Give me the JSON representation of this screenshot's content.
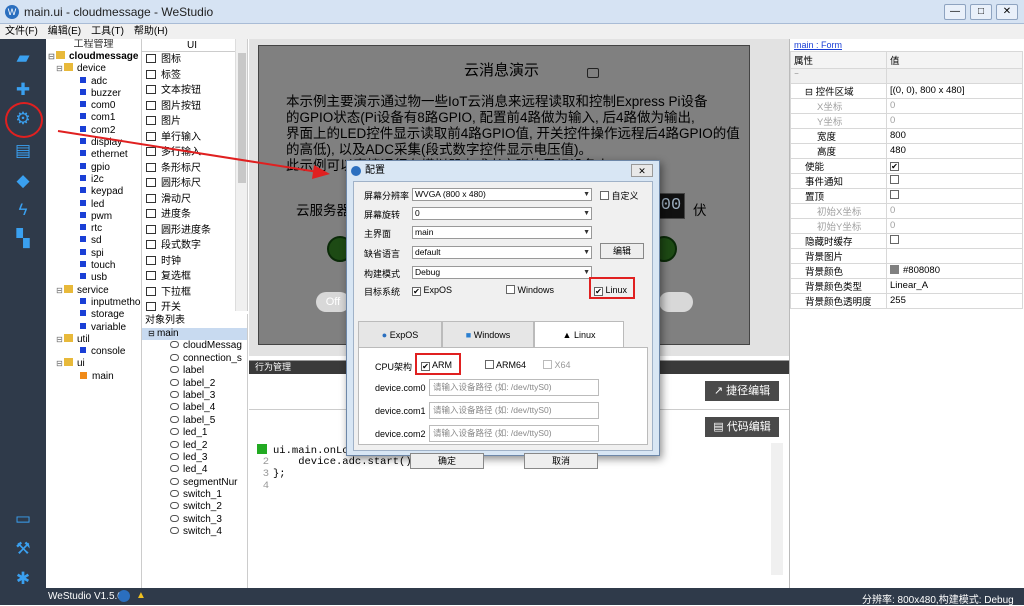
{
  "window": {
    "title": "main.ui - cloudmessage - WeStudio",
    "min": "—",
    "max": "□",
    "close": "✕"
  },
  "menu": [
    "文件(F)",
    "编辑(E)",
    "工具(T)",
    "帮助(H)"
  ],
  "project": {
    "header": "工程管理",
    "root": "cloudmessage",
    "device": {
      "label": "device",
      "children": [
        "adc",
        "buzzer",
        "com0",
        "com1",
        "com2",
        "display",
        "ethernet",
        "gpio",
        "i2c",
        "keypad",
        "led",
        "pwm",
        "rtc",
        "sd",
        "spi",
        "touch",
        "usb"
      ]
    },
    "service": {
      "label": "service",
      "children": [
        "inputmethod",
        "storage",
        "variable"
      ]
    },
    "util": {
      "label": "util",
      "children": [
        "console"
      ]
    },
    "ui": {
      "label": "ui",
      "children": [
        "main"
      ]
    }
  },
  "widgets": {
    "header": "UI",
    "items": [
      "图标",
      "标签",
      "文本按钮",
      "图片按钮",
      "图片",
      "单行输入",
      "多行输入",
      "条形标尺",
      "圆形标尺",
      "滑动尺",
      "进度条",
      "圆形进度条",
      "段式数字",
      "时钟",
      "复选框",
      "下拉框",
      "开关"
    ]
  },
  "objects": {
    "header": "对象列表",
    "root": "main",
    "items": [
      "cloudMessag",
      "connection_s",
      "label",
      "label_2",
      "label_3",
      "label_4",
      "label_5",
      "led_1",
      "led_2",
      "led_3",
      "led_4",
      "segmentNur",
      "switch_1",
      "switch_2",
      "switch_3",
      "switch_4"
    ]
  },
  "device_screen": {
    "title": "云消息演示",
    "lines": [
      "本示例主要演示通过物一些IoT云消息来远程读取和控制Express Pi设备",
      "的GPIO状态(Pi设备有8路GPIO, 配置前4路做为输入, 后4路做为输出,",
      "界面上的LED控件显示读取前4路GPIO值, 开关控件操作远程后4路GPIO的值",
      "的高低), 以及ADC采集(段式数字控件显示电压值)。",
      "此示例可以直接运行在模拟器上或者实际的目标设备上"
    ],
    "server_label": "云服务器",
    "volt_unit": "伏",
    "segment": "00",
    "switch_text": "Off"
  },
  "behavior": {
    "header": "行为管理",
    "quick_edit": "捷径编辑",
    "code_edit": "代码编辑"
  },
  "code": [
    {
      "n": "",
      "t": "ui.main.onLoad"
    },
    {
      "n": "2",
      "t": "    device.adc.start();"
    },
    {
      "n": "3",
      "t": "};"
    },
    {
      "n": "4",
      "t": ""
    }
  ],
  "props": {
    "link": "main : Form",
    "col_key": "属性",
    "col_val": "值",
    "rows": [
      {
        "k": "控件区域",
        "v": "[(0, 0), 800 x 480]",
        "gray": false
      },
      {
        "k": "X坐标",
        "v": "0",
        "gray": true
      },
      {
        "k": "Y坐标",
        "v": "0",
        "gray": true
      },
      {
        "k": "宽度",
        "v": "800",
        "gray": false
      },
      {
        "k": "高度",
        "v": "480",
        "gray": false
      },
      {
        "k": "使能",
        "v": "✔",
        "gray": false,
        "cb": true
      },
      {
        "k": "事件通知",
        "v": "",
        "gray": false,
        "cb": true
      },
      {
        "k": "置顶",
        "v": "",
        "gray": false,
        "cb": true
      },
      {
        "k": "初始X坐标",
        "v": "0",
        "gray": true
      },
      {
        "k": "初始Y坐标",
        "v": "0",
        "gray": true
      },
      {
        "k": "隐藏时缓存",
        "v": "",
        "gray": false,
        "cb": true
      },
      {
        "k": "背景图片",
        "v": "",
        "gray": false
      },
      {
        "k": "背景颜色",
        "v": "#808080",
        "gray": false,
        "swatch": "#808080"
      },
      {
        "k": "背景颜色类型",
        "v": "Linear_A",
        "gray": false
      },
      {
        "k": "背景颜色透明度",
        "v": "255",
        "gray": false
      }
    ]
  },
  "dialog": {
    "title": "配置",
    "close": "✕",
    "resolution_label": "屏幕分辨率",
    "resolution_value": "WVGA   (800 x 480)",
    "custom_label": "自定义",
    "rotation_label": "屏幕旋转",
    "rotation_value": "0",
    "main_label": "主界面",
    "main_value": "main",
    "lang_label": "缺省语言",
    "lang_value": "default",
    "edit_btn": "编辑",
    "build_label": "构建模式",
    "build_value": "Debug",
    "target_label": "目标系统",
    "targets": [
      {
        "label": "ExpOS",
        "checked": true
      },
      {
        "label": "Windows",
        "checked": false
      },
      {
        "label": "Linux",
        "checked": true
      }
    ],
    "tabs": [
      "ExpOS",
      "Windows",
      "Linux"
    ],
    "cpu_label": "CPU架构",
    "cpus": [
      {
        "label": "ARM",
        "checked": true
      },
      {
        "label": "ARM64",
        "checked": false
      },
      {
        "label": "X64",
        "checked": false
      }
    ],
    "ports": [
      {
        "label": "device.com0",
        "placeholder": "请输入设备路径 (如: /dev/ttyS0)"
      },
      {
        "label": "device.com1",
        "placeholder": "请输入设备路径 (如: /dev/ttyS0)"
      },
      {
        "label": "device.com2",
        "placeholder": "请输入设备路径 (如: /dev/ttyS0)"
      }
    ],
    "ok": "确定",
    "cancel": "取消"
  },
  "status": {
    "version": "WeStudio V1.5.0",
    "right": "分辨率: 800x480,构建模式: Debug"
  },
  "colors": {
    "accent": "#e02020",
    "sidebar": "#2f3a4a",
    "icon_blue": "#3aa0f0"
  }
}
